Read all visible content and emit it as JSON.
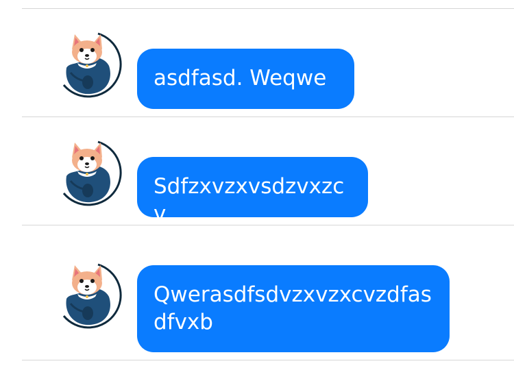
{
  "messages": [
    {
      "text": "asdfasd.  Weqwe",
      "avatar_icon": "corgi-avatar-icon"
    },
    {
      "text": "Sdfzxvzxvsdzvxzcv",
      "avatar_icon": "corgi-avatar-icon"
    },
    {
      "text": "Qwerasdfsdvzxvzxcvzdfasdfvxb",
      "avatar_icon": "corgi-avatar-icon"
    }
  ],
  "colors": {
    "bubble": "#0a7cff",
    "bubble_text": "#ffffff",
    "divider": "#d6d6d6",
    "avatar_body": "#1f4f7a",
    "avatar_ring": "#0f2a3d"
  }
}
